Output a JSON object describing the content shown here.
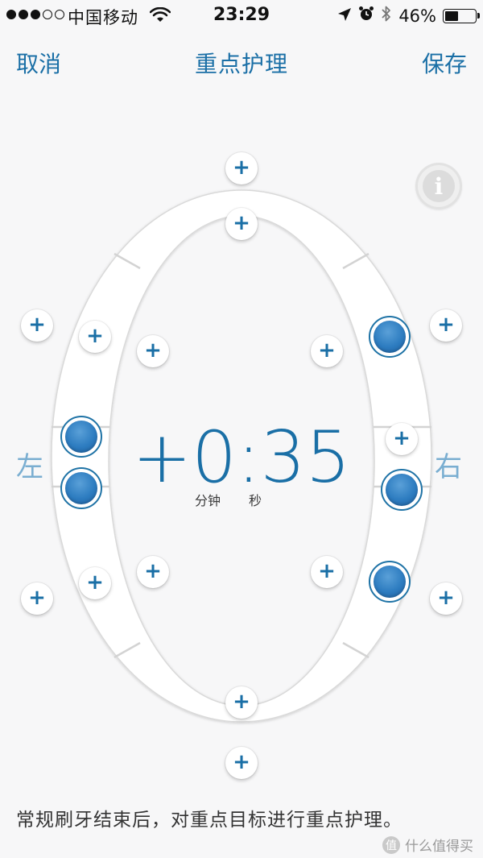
{
  "status_bar": {
    "carrier": "中国移动",
    "time": "23:29",
    "battery_percent": "46%",
    "battery_level": 0.46,
    "signal_bars_filled": 3,
    "signal_bars_total": 5
  },
  "nav": {
    "cancel_label": "取消",
    "title": "重点护理",
    "save_label": "保存"
  },
  "info_button": {
    "glyph": "i"
  },
  "plus_glyph": "+",
  "labels": {
    "left": "左",
    "right": "右"
  },
  "timer": {
    "value": "+0:35",
    "minutes_unit": "分钟",
    "seconds_unit": "秒"
  },
  "description": "常规刷牙结束后，对重点目标进行重点护理。",
  "watermark": {
    "badge": "值",
    "text": "什么值得买"
  },
  "colors": {
    "accent": "#1a6fa6",
    "side_label": "#7aaed1",
    "selected_ball": "#2d7cc0"
  }
}
